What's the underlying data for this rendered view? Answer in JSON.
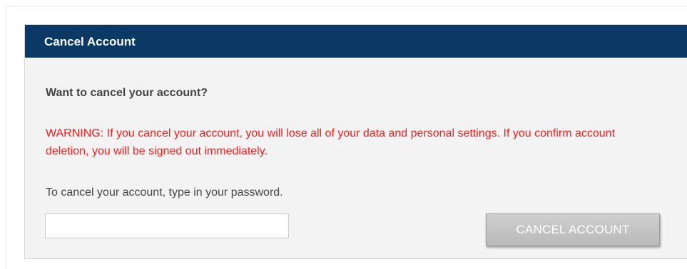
{
  "panel": {
    "title": "Cancel Account",
    "question": "Want to cancel your account?",
    "warning": "WARNING: If you cancel your account, you will lose all of your data and personal settings. If you confirm account deletion, you will be signed out immediately.",
    "instruction": "To cancel your account, type in your password.",
    "password_value": "",
    "password_placeholder": "",
    "button_label": "CANCEL ACCOUNT"
  },
  "colors": {
    "header_bg": "#0b3966",
    "warning_text": "#ff1a1a",
    "body_bg": "#f3f3f3",
    "button_bg": "#c4c4c4"
  }
}
